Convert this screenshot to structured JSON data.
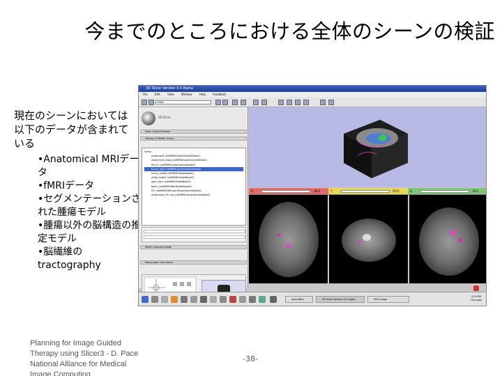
{
  "title": "今までのところにおける全体のシーンの検証",
  "intro": "現在のシーンにおいては以下のデータが含まれている",
  "bullets": [
    "•Anatomical MRIデータ",
    "•fMRIデータ",
    "•セグメンテーションされた腫瘍モデル",
    "•腫瘍以外の脳構造の推定モデル",
    "•脳繊維のtractography"
  ],
  "footer": "Planning for Image Guided Therapy using Slicer3 - D. Pace National Alliance for Medical Image Computing",
  "page_number": "-38-",
  "screenshot": {
    "window_title": "3D Slicer Version 3.4 Alpha",
    "menu": [
      "File",
      "Edit",
      "View",
      "Window",
      "Help",
      "Feedback"
    ],
    "module_label": "Data",
    "logo_text": "3D Slicer",
    "section_display": "Data: Scene Browser",
    "section_hierarchy": "Display & Modify Scene",
    "section_props": "Modify Selected Node",
    "section_manip": "Manipulate Slice Views",
    "tree_root": "Scene",
    "tree_items": [
      "anatomical (vtkMRMLScalarVolumeNode1)",
      "anatomical_imag (vtkMRMLScalarVolumeNode2)",
      "fmri_fc (vtkMRMLScalarVolumeNode3)",
      "tumor_label (vtkMRMLScalarVolumeNode4)",
      "tumor_model (vtkMRMLModelNode1)",
      "white_matter (vtkMRMLModelNode2)",
      "optic_tract (vtkMRMLModelNode3)",
      "fibers (vtkMRMLFiberBundleNode1)",
      "DTI (vtkMRMLDiffusionTensorVolumeNode1)",
      "anatomical_DTI_reg (vtkMRMLScalarVolumeNode5)"
    ],
    "selected_index": 3,
    "view_labels": [
      "R",
      "Y",
      "G"
    ],
    "view_values": [
      "-38.0",
      "55.6",
      "18.6"
    ],
    "taskbar_items": [
      "dpace@ns",
      "3D Slicer Version 3.4 Alpha",
      "PNG image"
    ],
    "clock": "2:20 PM Thursday"
  }
}
